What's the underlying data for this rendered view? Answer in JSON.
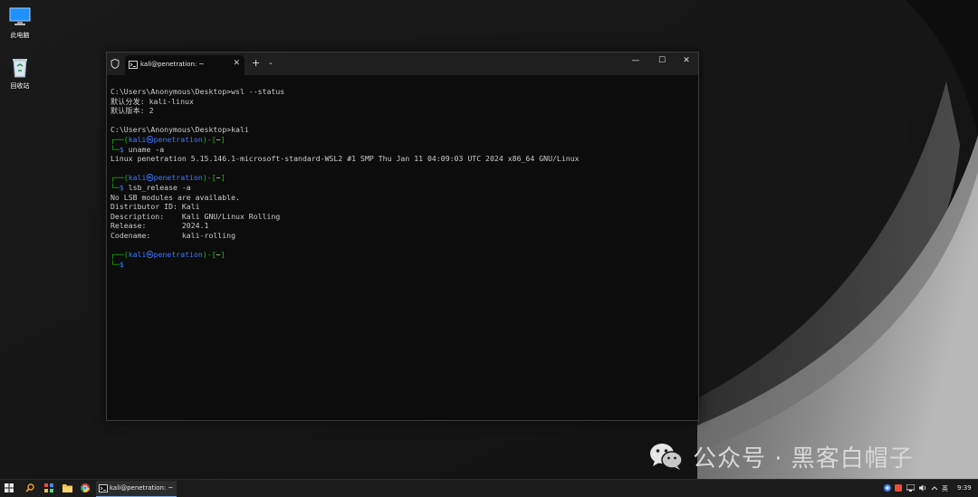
{
  "desktop": {
    "icons": [
      {
        "label": "此电脑",
        "icon": "monitor-icon"
      },
      {
        "label": "回收站",
        "icon": "recycle-bin-icon"
      }
    ]
  },
  "terminal": {
    "tab_title": "kali@penetration: ~",
    "tab_close": "✕",
    "new_tab": "+",
    "dropdown": "⌄",
    "minimize": "—",
    "maximize": "☐",
    "close": "✕",
    "lines": {
      "l1": "C:\\Users\\Anonymous\\Desktop>wsl --status",
      "l2": "默认分发: kali-linux",
      "l3": "默认版本: 2",
      "l4": "C:\\Users\\Anonymous\\Desktop>kali",
      "p_open": "┌──(",
      "p_user": "kali㉿penetration",
      "p_mid": ")-[",
      "p_dir": "~",
      "p_close": "]",
      "p_bottom": "└─",
      "p_dollar": "$",
      "cmd1": " uname -a",
      "out1": "Linux penetration 5.15.146.1-microsoft-standard-WSL2 #1 SMP Thu Jan 11 04:09:03 UTC 2024 x86_64 GNU/Linux",
      "cmd2": " lsb_release -a",
      "out2a": "No LSB modules are available.",
      "out2b": "Distributor ID: Kali",
      "out2c": "Description:    Kali GNU/Linux Rolling",
      "out2d": "Release:        2024.1",
      "out2e": "Codename:       kali-rolling"
    }
  },
  "watermark": {
    "text": "公众号 · 黑客白帽子",
    "icon": "wechat-icon"
  },
  "taskbar": {
    "start_icon": "windows-start-icon",
    "search_icon": "search-icon",
    "apps": [
      "task-view-icon",
      "file-explorer-icon",
      "chrome-icon"
    ],
    "active_window_label": "kali@penetration: ~",
    "tray": {
      "ime": "英",
      "time": "9:39"
    }
  },
  "colors": {
    "prompt_green": "#16c60c",
    "prompt_blue": "#3b78ff",
    "terminal_bg": "#0c0c0c",
    "terminal_text": "#cccccc"
  }
}
